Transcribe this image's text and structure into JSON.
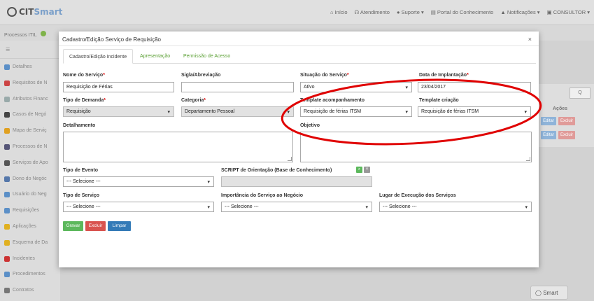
{
  "app": {
    "logo_prefix": "CIT",
    "logo_suffix": "Smart",
    "topnav": [
      "⌂ Início",
      "☊ Atendimento",
      "● Suporte ▾",
      "▤ Portal do Conhecimento",
      "▲ Notificações ▾",
      "▣ CONSULTOR ▾"
    ],
    "process_bar": "Processos ITIL",
    "sidebar_items": [
      "Detalhes",
      "Requisitos de N",
      "Atributos Financ",
      "Casos de Negó",
      "Mapa de Serviç",
      "Processos de N",
      "Serviços de Apo",
      "Dono do Negóc",
      "Usuário do Neg",
      "Requisições",
      "Aplicações",
      "Esquema de Da",
      "Incidentes",
      "Procedimentos",
      "Contratos"
    ],
    "sidebar_colors": [
      "#5b8fc7",
      "#c44",
      "#9aa",
      "#444",
      "#e0a020",
      "#557",
      "#555",
      "#5577aa",
      "#5b8fc7",
      "#5b8fc7",
      "#e0b020",
      "#e0b020",
      "#c33",
      "#5b8fc7",
      "#777"
    ],
    "right_panel": {
      "acoes": "Ações",
      "edit": "Editar",
      "delete": "Excluir",
      "search_icon": "Q"
    },
    "smart_button": "Smart"
  },
  "modal": {
    "title": "Cadastro/Edição Serviço de Requisição",
    "close": "×",
    "tabs": [
      "Cadastro/Edição Incidente",
      "Apresentação",
      "Permissão de Acesso"
    ],
    "fields": {
      "nome_servico": {
        "label": "Nome do Serviço",
        "value": "Requisição de Férias"
      },
      "sigla": {
        "label": "Sigla/Abreviação",
        "value": ""
      },
      "situacao": {
        "label": "Situação do Serviço",
        "value": "Ativo"
      },
      "data_implantacao": {
        "label": "Data de Implantação",
        "value": "23/04/2017"
      },
      "tipo_demanda": {
        "label": "Tipo de Demanda",
        "value": "Requisição"
      },
      "categoria": {
        "label": "Categoria",
        "value": "Departamento Pessoal"
      },
      "template_acompanhamento": {
        "label": "Template acompanhamento",
        "value": "Requisição de férias ITSM"
      },
      "template_criacao": {
        "label": "Template criação",
        "value": "Requisição de férias ITSM"
      },
      "detalhamento": {
        "label": "Detalhamento"
      },
      "objetivo": {
        "label": "Objetivo"
      },
      "tipo_evento": {
        "label": "Tipo de Evento",
        "value": "--- Selecione ---"
      },
      "script": {
        "label": "SCRIPT de Orientação (Base de Conhecimento)"
      },
      "tipo_servico": {
        "label": "Tipo de Serviço",
        "value": "--- Selecione ---"
      },
      "importancia": {
        "label": "Importância do Serviço ao Negócio",
        "value": "--- Selecione ---"
      },
      "lugar_execucao": {
        "label": "Lugar de Execução dos Serviços",
        "value": "--- Selecione ---"
      }
    },
    "required_mark": "*",
    "buttons": {
      "save": "Gravar",
      "delete": "Excluir",
      "clear": "Limpar"
    },
    "colors": {
      "save": "#5cb85c",
      "delete": "#d9534f",
      "clear": "#337ab7",
      "tab_link": "#5a9f33",
      "highlight": "#e00000"
    }
  }
}
